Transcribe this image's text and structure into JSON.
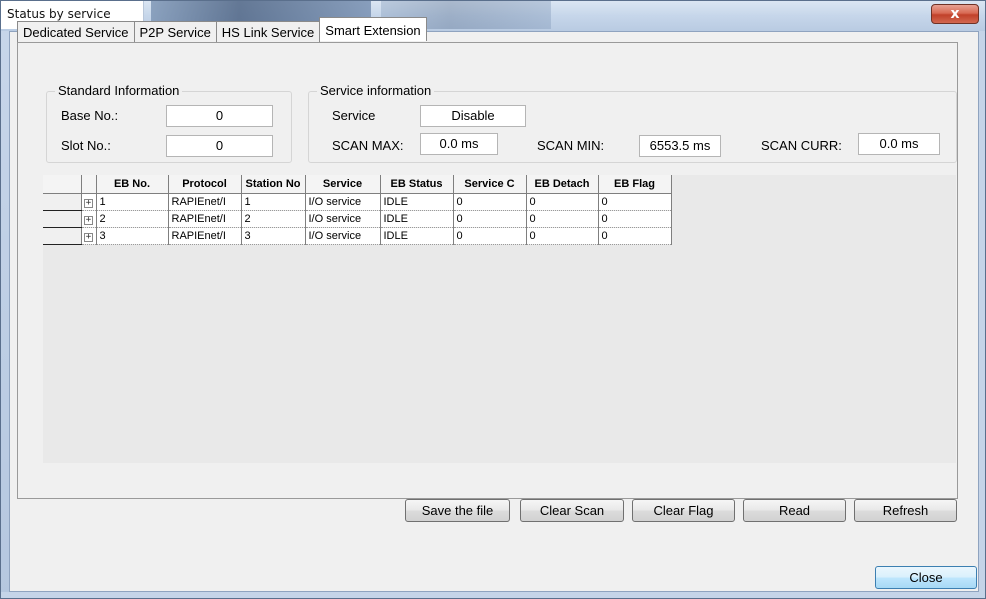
{
  "window": {
    "title": "Status by service",
    "close_glyph": "x"
  },
  "tabs": [
    {
      "label": "Dedicated Service"
    },
    {
      "label": "P2P Service"
    },
    {
      "label": "HS Link Service"
    },
    {
      "label": "Smart Extension"
    }
  ],
  "standard_info": {
    "title": "Standard Information",
    "base_label": "Base No.:",
    "base_value": "0",
    "slot_label": "Slot No.:",
    "slot_value": "0"
  },
  "service_info": {
    "title": "Service information",
    "service_label": "Service",
    "service_value": "Disable",
    "scan_max_label": "SCAN MAX:",
    "scan_max_value": "0.0 ms",
    "scan_min_label": "SCAN MIN:",
    "scan_min_value": "6553.5 ms",
    "scan_curr_label": "SCAN CURR:",
    "scan_curr_value": "0.0 ms"
  },
  "grid": {
    "headers": [
      "EB No.",
      "Protocol",
      "Station No",
      "Service",
      "EB Status",
      "Service C",
      "EB Detach",
      "EB Flag"
    ],
    "rows": [
      [
        "1",
        "RAPIEnet/I",
        "1",
        "I/O service",
        "IDLE",
        "0",
        "0",
        "0"
      ],
      [
        "2",
        "RAPIEnet/I",
        "2",
        "I/O service",
        "IDLE",
        "0",
        "0",
        "0"
      ],
      [
        "3",
        "RAPIEnet/I",
        "3",
        "I/O service",
        "IDLE",
        "0",
        "0",
        "0"
      ]
    ],
    "expander_glyph": "+"
  },
  "buttons": {
    "save": "Save the file",
    "clear_scan": "Clear Scan",
    "clear_flag": "Clear Flag",
    "read": "Read",
    "refresh": "Refresh",
    "close": "Close"
  }
}
